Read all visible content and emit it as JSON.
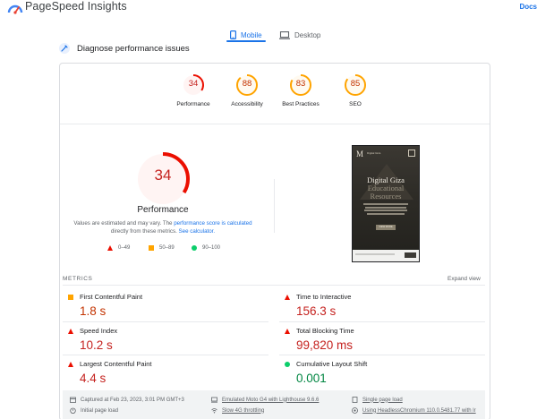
{
  "header": {
    "title": "PageSpeed Insights",
    "docs_label": "Docs"
  },
  "tabs": [
    {
      "label": "Mobile",
      "icon": "phone-icon",
      "active": true
    },
    {
      "label": "Desktop",
      "icon": "laptop-icon",
      "active": false
    }
  ],
  "diagnose": {
    "title": "Diagnose performance issues"
  },
  "categories": [
    {
      "label": "Performance",
      "score": "34",
      "value": 34,
      "status": "fail"
    },
    {
      "label": "Accessibility",
      "score": "88",
      "value": 88,
      "status": "average"
    },
    {
      "label": "Best Practices",
      "score": "83",
      "value": 83,
      "status": "average"
    },
    {
      "label": "SEO",
      "score": "85",
      "value": 85,
      "status": "average"
    }
  ],
  "performance": {
    "score": "34",
    "value": 34,
    "title": "Performance",
    "desc_prefix": "Values are estimated and may vary. The ",
    "desc_link": "performance score is calculated",
    "desc_middle": " directly from these metrics. ",
    "desc_calc_link": "See calculator.",
    "legend": [
      {
        "range": "0–49",
        "icon": "fail-triangle-icon"
      },
      {
        "range": "50–89",
        "icon": "average-square-icon"
      },
      {
        "range": "90–100",
        "icon": "pass-circle-icon"
      }
    ]
  },
  "screenshot": {
    "logo": "M",
    "nav": "Digital Giza",
    "headline_1": "Digital Giza",
    "headline_2": "Educational Resources",
    "cta": "VIEW MORE"
  },
  "metrics": {
    "label": "METRICS",
    "expand_label": "Expand view",
    "items": [
      {
        "name": "First Contentful Paint",
        "value": "1.8 s",
        "status": "average"
      },
      {
        "name": "Time to Interactive",
        "value": "156.3 s",
        "status": "fail"
      },
      {
        "name": "Speed Index",
        "value": "10.2 s",
        "status": "fail"
      },
      {
        "name": "Total Blocking Time",
        "value": "99,820 ms",
        "status": "fail"
      },
      {
        "name": "Largest Contentful Paint",
        "value": "4.4 s",
        "status": "fail"
      },
      {
        "name": "Cumulative Layout Shift",
        "value": "0.001",
        "status": "pass"
      }
    ]
  },
  "info": {
    "captured": "Captured at Feb 23, 2023, 3:01 PM GMT+3",
    "initial_load": "Initial page load",
    "emulated": "Emulated Moto G4 with Lighthouse 9.6.6",
    "throttling": "Slow 4G throttling",
    "single_load": "Single page load",
    "browser": "Using HeadlessChromium 110.0.5481.77 with lr"
  },
  "colors": {
    "fail": "#eb0f00",
    "fail_text": "#c5221f",
    "average": "#ffa400",
    "average_text": "#c33300",
    "pass": "#0cce6b",
    "pass_text": "#018642",
    "accent": "#1a73e8"
  }
}
